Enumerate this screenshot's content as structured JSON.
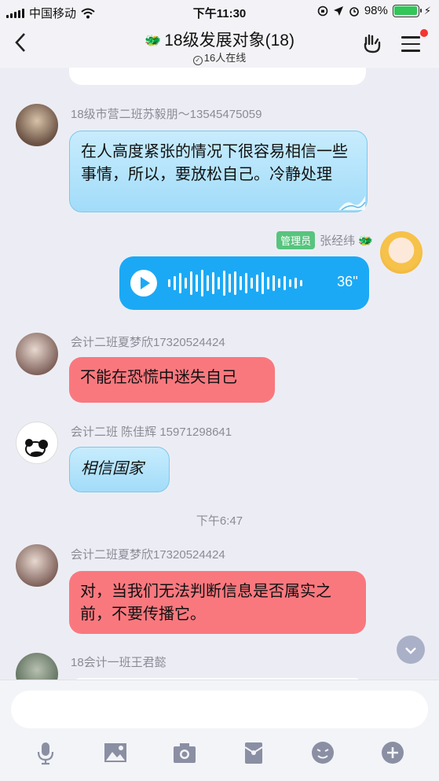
{
  "status_bar": {
    "carrier": "中国移动",
    "time": "下午11:30",
    "battery": "98%",
    "battery_level": 0.98
  },
  "header": {
    "title": "18级发展对象(18)",
    "online": "16人在线"
  },
  "messages": [
    {
      "sender": "18级市营二班苏毅朋～13545475059",
      "text": "在人高度紧张的情况下很容易相信一些事情，所以，要放松自己。冷静处理"
    },
    {
      "badge": "管理员",
      "sender": "张经纬",
      "voice_duration": "36''"
    },
    {
      "sender": "会计二班夏梦欣17320524424",
      "text": "不能在恐慌中迷失自己"
    },
    {
      "sender": "会计二班 陈佳辉 15971298641",
      "text": "相信国家"
    },
    {
      "timestamp": "下午6:47"
    },
    {
      "sender": "会计二班夏梦欣17320524424",
      "text": "对，当我们无法判断信息是否属实之前，不要传播它。"
    },
    {
      "sender": "18会计一班王君懿"
    }
  ],
  "colors": {
    "blue_bubble": "#a2dcf9",
    "red_bubble": "#f9787e",
    "voice_bubble": "#1ba9f5",
    "admin_badge": "#58c47e"
  },
  "toolbar_icons": [
    "mic-icon",
    "image-icon",
    "camera-icon",
    "red-packet-icon",
    "emoji-icon",
    "plus-icon"
  ]
}
